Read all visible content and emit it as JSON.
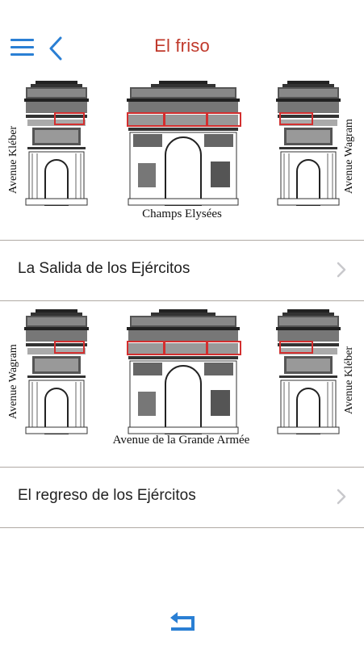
{
  "header": {
    "title": "El friso",
    "menu_icon": "hamburger-menu-icon",
    "back_icon": "chevron-left-icon",
    "accent_color": "#2a7fd4",
    "title_color": "#c0392b"
  },
  "diagram_top": {
    "left_label": "Avenue Kléber",
    "right_label": "Avenue Wagram",
    "bottom_label": "Champs Elysées"
  },
  "diagram_bottom": {
    "left_label": "Avenue Wagram",
    "right_label": "Avenue Kléber",
    "bottom_label": "Avenue de la Grande Armée"
  },
  "rows": [
    {
      "label": "La Salida de los Ejércitos",
      "icon": "chevron-right-icon"
    },
    {
      "label": "El regreso de los Ejércitos",
      "icon": "chevron-right-icon"
    }
  ],
  "footer": {
    "icon": "return-arrow-icon"
  },
  "highlight_color": "#d32f2f"
}
